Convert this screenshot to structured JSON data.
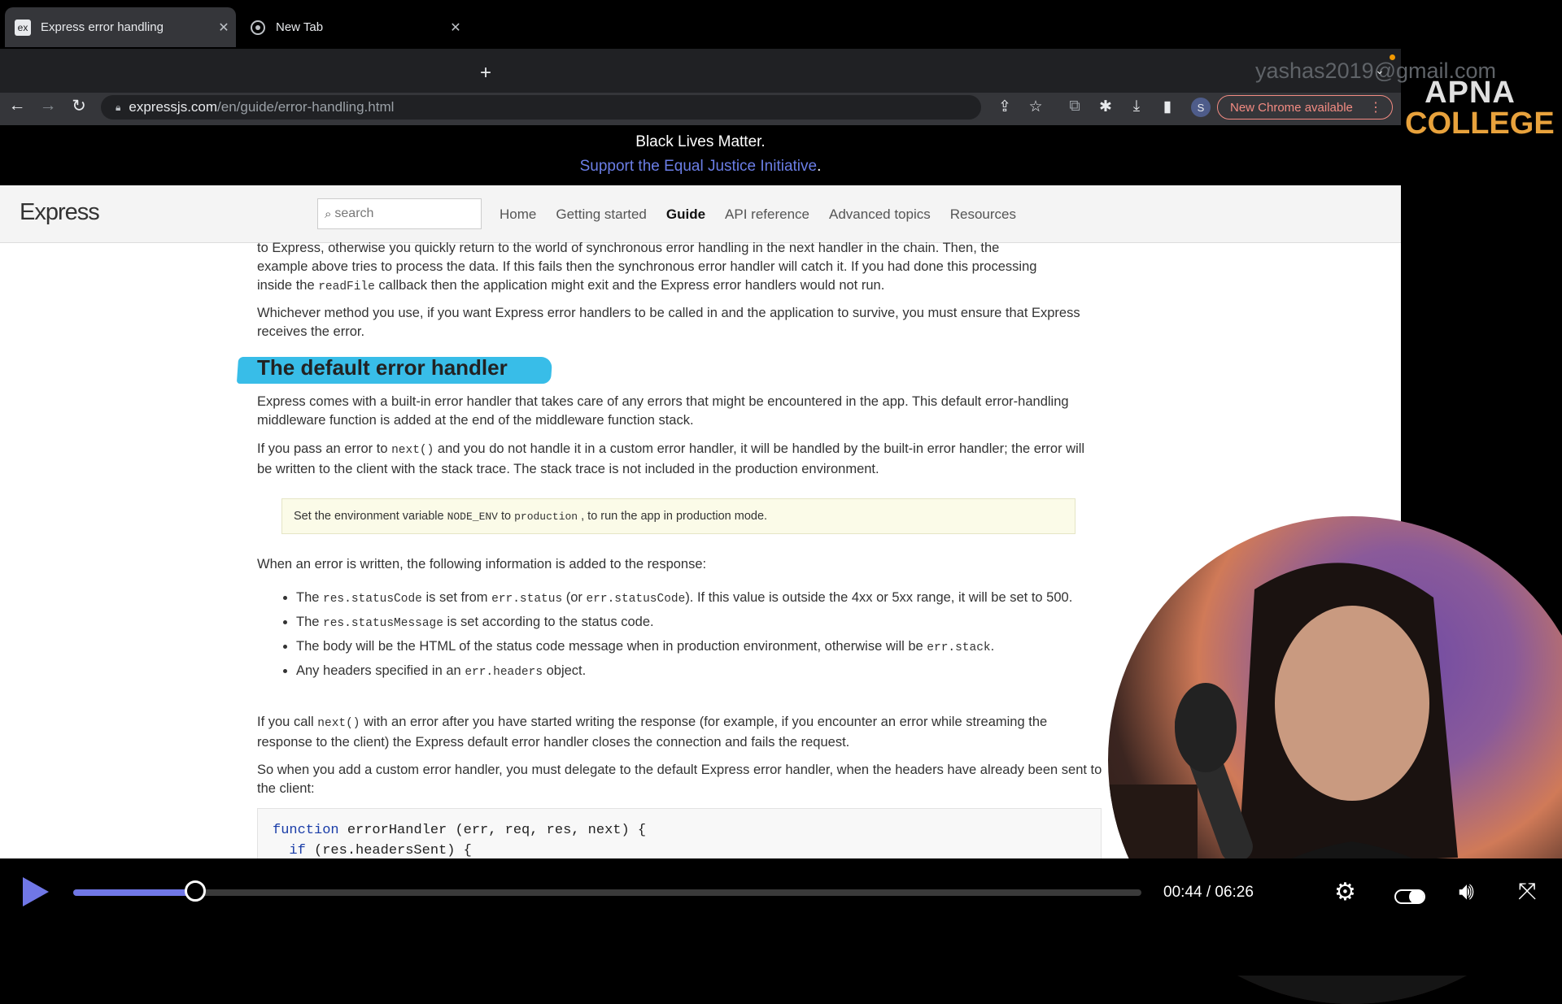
{
  "browser": {
    "tabs": [
      {
        "favicon": "ex",
        "title": "Express error handling",
        "close": "✕"
      },
      {
        "favicon": "chrome-icon",
        "title": "New Tab",
        "close": "✕"
      }
    ],
    "new_tab_symbol": "+",
    "account_watermark": "yashas2019@gmail.com",
    "url_host": "expressjs.com",
    "url_path": "/en/guide/error-handling.html",
    "profile_initial": "S",
    "update_button_label": "New Chrome available"
  },
  "logo_overlay": {
    "line1": "APNA",
    "line2": "COLLEGE"
  },
  "banner": {
    "line1": "Black Lives Matter.",
    "link": "Support the Equal Justice Initiative",
    "link_suffix": "."
  },
  "site": {
    "logo": "Express",
    "search_placeholder": "search",
    "nav": [
      "Home",
      "Getting started",
      "Guide",
      "API reference",
      "Advanced topics",
      "Resources"
    ],
    "active_nav": "Guide"
  },
  "article": {
    "p1_line1": "to Express, otherwise you quickly return to the world of synchronous error handling in the next handler in the chain. Then, the",
    "p1_line2": "example above tries to process the data. If this fails then the synchronous error handler will catch it. If you had done this processing",
    "p1_line3_a": "inside the ",
    "p1_line3_code": "readFile",
    "p1_line3_b": " callback then the application might exit and the Express error handlers would not run.",
    "p2": "Whichever method you use, if you want Express error handlers to be called in and the application to survive, you must ensure that Express receives the error.",
    "heading": "The default error handler",
    "p3": "Express comes with a built-in error handler that takes care of any errors that might be encountered in the app. This default error-handling middleware function is added at the end of the middleware function stack.",
    "p4_a": "If you pass an error to ",
    "p4_code": "next()",
    "p4_b": " and you do not handle it in a custom error handler, it will be handled by the built-in error handler; the error will be written to the client with the stack trace. The stack trace is not included in the production environment.",
    "note_a": "Set the environment variable ",
    "note_code1": "NODE_ENV",
    "note_b": " to ",
    "note_code2": "production",
    "note_c": ", to run the app in production mode.",
    "p5": "When an error is written, the following information is added to the response:",
    "b1_a": "The ",
    "b1_code1": "res.statusCode",
    "b1_b": " is set from ",
    "b1_code2": "err.status",
    "b1_c": " (or ",
    "b1_code3": "err.statusCode",
    "b1_d": "). If this value is outside the 4xx or 5xx range, it will be set to 500.",
    "b2_a": "The ",
    "b2_code": "res.statusMessage",
    "b2_b": " is set according to the status code.",
    "b3_a": "The body will be the HTML of the status code message when in production environment, otherwise will be ",
    "b3_code": "err.stack",
    "b3_b": ".",
    "b4_a": "Any headers specified in an ",
    "b4_code": "err.headers",
    "b4_b": " object.",
    "p6_a": "If you call ",
    "p6_code": "next()",
    "p6_b": " with an error after you have started writing the response (for example, if you encounter an error while streaming the response to the client) the Express default error handler closes the connection and fails the request.",
    "p7": "So when you add a custom error handler, you must delegate to the default Express error handler, when the headers have already been sent to the client:",
    "code_kw": "function",
    "code_line1_rest": " errorHandler (err, req, res, next) {",
    "code_line2_kw": "  if",
    "code_line2_rest": " (res.headersSent) {"
  },
  "player": {
    "time": "00:44 / 06:26",
    "progress_fraction": 0.114,
    "accent": "#7077e6"
  }
}
